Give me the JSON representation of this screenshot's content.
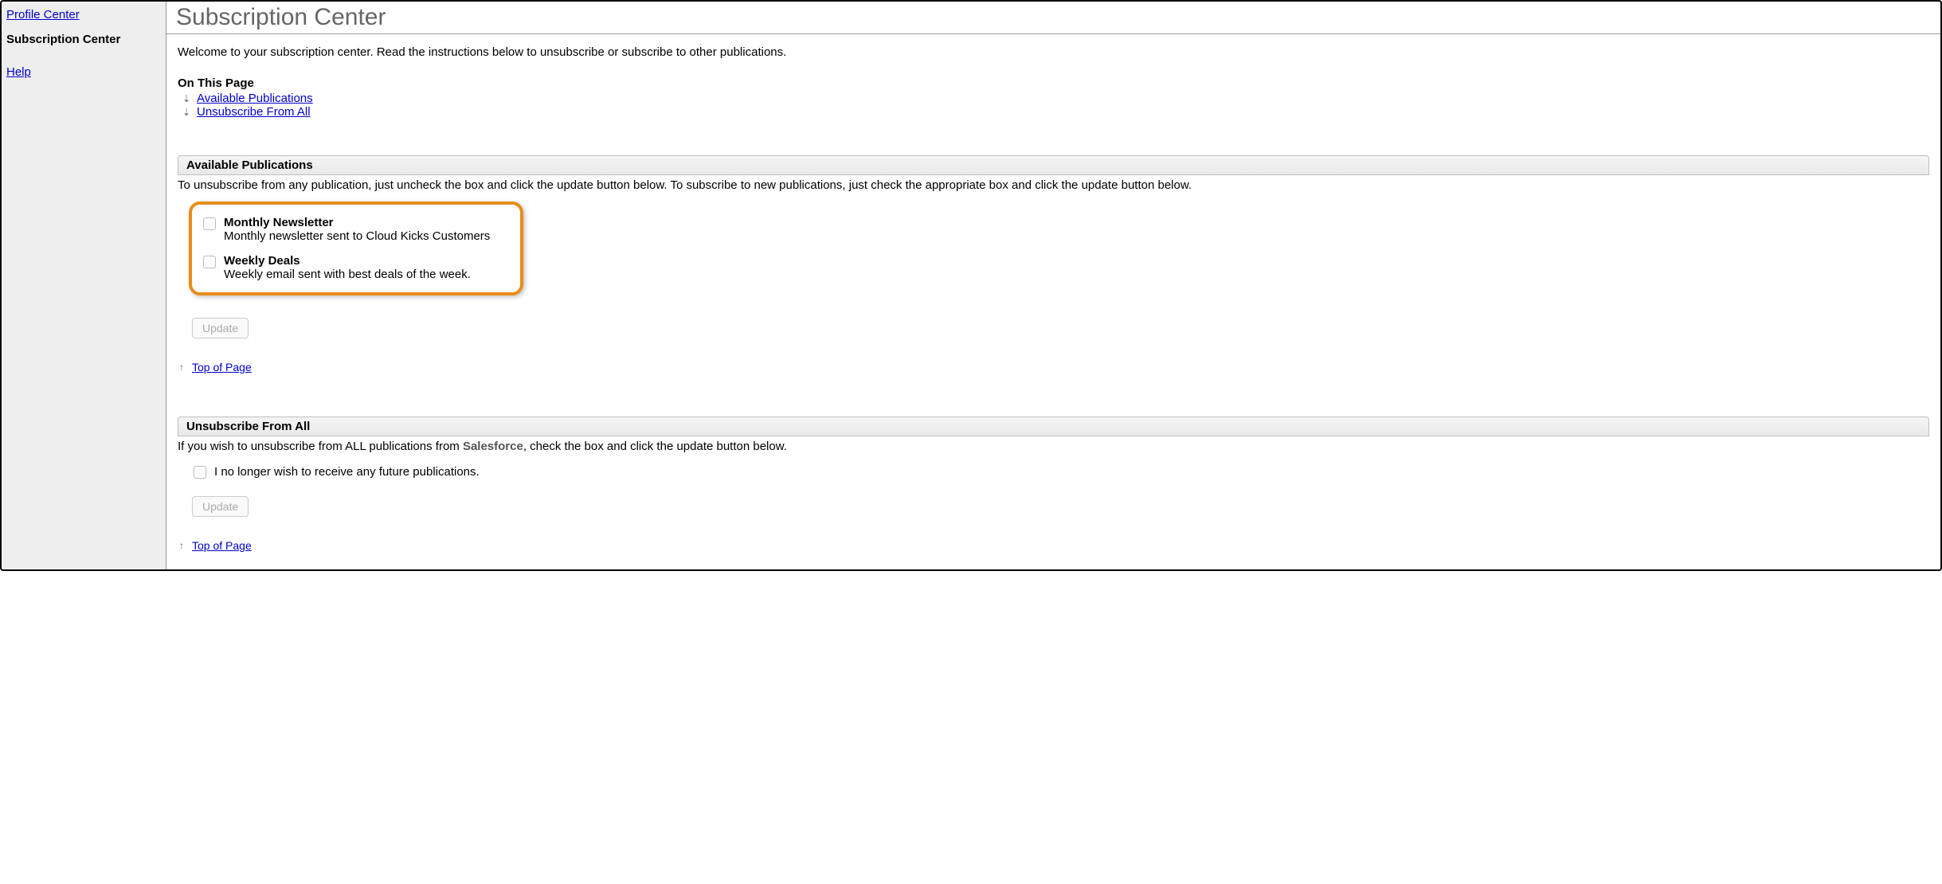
{
  "sidebar": {
    "profile_center": "Profile Center",
    "subscription_center": "Subscription Center",
    "help": "Help"
  },
  "page_title": "Subscription Center",
  "intro": "Welcome to your subscription center. Read the instructions below to unsubscribe or subscribe to other publications.",
  "on_this_page": {
    "label": "On This Page",
    "links": [
      "Available Publications",
      "Unsubscribe From All"
    ]
  },
  "sections": {
    "available": {
      "header": "Available Publications",
      "desc": "To unsubscribe from any publication, just uncheck the box and click the update button below. To subscribe to new publications, just check the appropriate box and click the update button below.",
      "publications": [
        {
          "title": "Monthly Newsletter",
          "desc": "Monthly newsletter sent to Cloud Kicks Customers"
        },
        {
          "title": "Weekly Deals",
          "desc": "Weekly email sent with best deals of the week."
        }
      ],
      "update_label": "Update"
    },
    "unsubscribe": {
      "header": "Unsubscribe From All",
      "desc_pre": "If you wish to unsubscribe from ALL publications from ",
      "company": "Salesforce",
      "desc_post": ", check the box and click the update button below.",
      "checkbox_label": "I no longer wish to receive any future publications.",
      "update_label": "Update"
    }
  },
  "top_of_page": "Top of Page"
}
